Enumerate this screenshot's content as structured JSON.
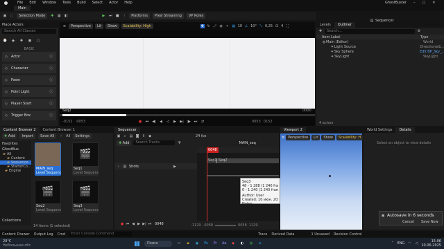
{
  "app": {
    "title": "GhostBuster",
    "level_tab": "Main",
    "menu": [
      "File",
      "Edit",
      "Window",
      "Tools",
      "Build",
      "Select",
      "Actor",
      "Help"
    ],
    "window_controls": [
      "–",
      "▢",
      "✕"
    ]
  },
  "toolbar": {
    "selection_mode": "Selection Mode",
    "platforms": "Platforms",
    "pixel_streaming": "Pixel Streaming",
    "vp_roles": "VP Roles"
  },
  "place_actors": {
    "title": "Place Actors",
    "search_placeholder": "Search All Classes",
    "basic_label": "BASIC",
    "items": [
      "Actor",
      "Character",
      "Pawn",
      "Point Light",
      "Player Start",
      "Trigger Box"
    ]
  },
  "viewport_main": {
    "perspective": "Perspective",
    "lit": "Lit",
    "show": "Show",
    "scalability": "Scalability: High",
    "grid_value": "10",
    "angle_value": "10°",
    "scale_value": "0,25",
    "camera_speed": "4",
    "shot_label": "Seq2",
    "frame_left": "0000",
    "frame_right": "0000",
    "frame_in": "-0152",
    "frame_in2": "-0053",
    "frame_out": "0152",
    "frame_out2": "0053"
  },
  "outliner": {
    "levels_tab": "Levels",
    "outliner_tab": "Outliner",
    "search_placeholder": "Search...",
    "col_label": "Item Label",
    "col_type": "Type",
    "items": [
      {
        "label": "Main (Editor)",
        "type": "World"
      },
      {
        "label": "Light Source",
        "type": "DirectionalLi..."
      },
      {
        "label": "Sky Sphere",
        "type": "Edit BP_Sky_..."
      },
      {
        "label": "SkyLight",
        "type": "SkyLight"
      }
    ],
    "footer": "4 actors",
    "sequencer_link": "Sequencer"
  },
  "content_browser": {
    "tab1": "Content Browser 2",
    "tab2": "Content Browser 1",
    "add": "Add",
    "import": "Import",
    "save_all": "Save All",
    "settings": "Settings",
    "breadcrumb": "All",
    "favorites": "Favorites",
    "ghostbus": "GhostBus",
    "tree": [
      "All",
      "Content",
      "Sequence",
      "StarterCo...",
      "Engine"
    ],
    "collections": "Collections",
    "assets": [
      {
        "name": "MAIN_seq",
        "type": "Level Sequence"
      },
      {
        "name": "Seq1",
        "type": "Level Sequence"
      },
      {
        "name": "Seq2",
        "type": "Level Sequence"
      },
      {
        "name": "Seq3",
        "type": "Level Sequence"
      }
    ],
    "status": "14 items (1 selected)",
    "search_placeholder": "Search Sequence"
  },
  "sequencer": {
    "tab": "Sequencer",
    "add": "Add",
    "search_placeholder": "Search Tracks",
    "fps": "24 fps",
    "breadcrumb": "MAIN_seq",
    "playhead": "0048",
    "track": "Shots",
    "shot1": "Seq1",
    "shot2": "Seq2",
    "time_left": "-1129",
    "time_left2": "-0058",
    "time_right": "1129",
    "time_right2": "0058",
    "current_frame": "0048",
    "tooltip": [
      "Seq3",
      "48 - 1 288 (1 240 frames)",
      "0 - 1 240 (1 240 frames @ 25 fps)",
      "Author: User",
      "Created: 10 июн. 2025 г., 15:07:33",
      "Notes"
    ],
    "status": "0 of 1 selected"
  },
  "viewport2": {
    "tab": "Viewport 2",
    "perspective": "Perspective",
    "lit": "Lit",
    "show": "Show",
    "scalability": "Scalability: H"
  },
  "details": {
    "world_settings_tab": "World Settings",
    "details_tab": "Details",
    "empty_text": "Select an object to view details"
  },
  "toast": {
    "title": "Autosave in 6 seconds",
    "cancel": "Cancel",
    "save_now": "Save Now"
  },
  "statusbar": {
    "content_drawer": "Content Drawer",
    "output_log": "Output Log",
    "cmd": "Cmd",
    "console_placeholder": "Enter Console Command",
    "trace": "Trace",
    "derived_data": "Derived Data",
    "unsaved": "1 Unsaved",
    "revision_control": "Revision Control"
  },
  "taskbar": {
    "weather_temp": "20°C",
    "weather_text": "Небольшая облачность",
    "search": "Поиск",
    "lang": "ENG",
    "time": "15:06",
    "date": "10.06.2025"
  }
}
